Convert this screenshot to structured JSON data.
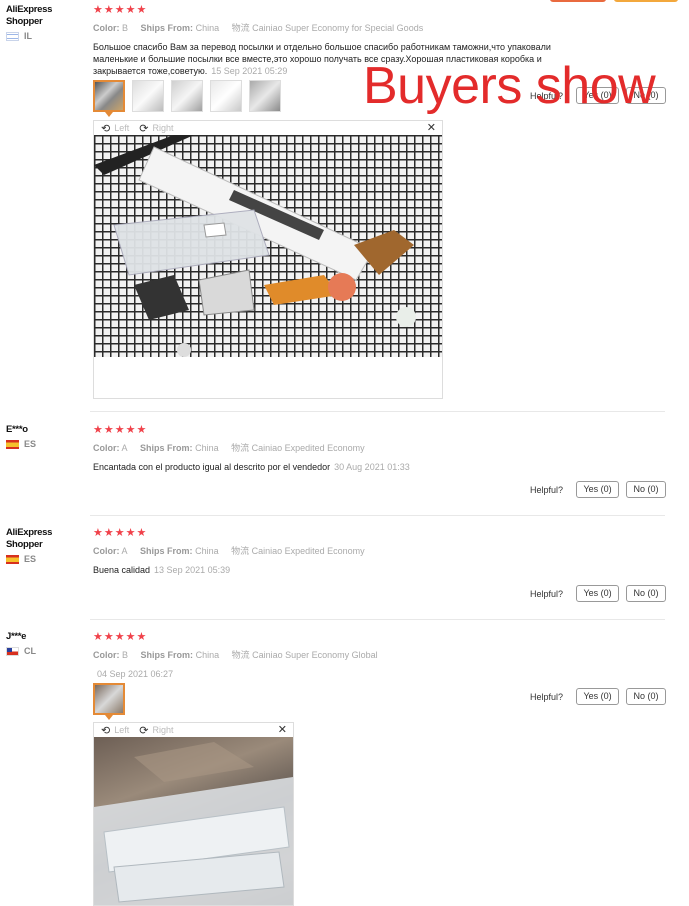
{
  "colors": {
    "star": "#f0414a",
    "accent": "#e48a36",
    "watermark": "#e32b2b"
  },
  "watermark": "Buyers show",
  "labels": {
    "color": "Color:",
    "ships_from": "Ships From:",
    "helpful": "Helpful?",
    "left": "Left",
    "right": "Right",
    "stars": "★★★★★"
  },
  "reviews": [
    {
      "user": "AliExpress Shopper",
      "country": "IL",
      "color": "B",
      "ships_from": "China",
      "logistics": "物流 Cainiao Super Economy for Special Goods",
      "text": "Большое спасибо Вам за перевод посылки и отдельно большое спасибо работникам таможни,что упаковали маленькие и большие посылки все вместе,это хорошо получать все сразу.Хорошая пластиковая коробка и закрывается тоже,советую.",
      "date": "15 Sep 2021 05:29",
      "yes": "Yes (0)",
      "no": "No (0)",
      "thumbs": 5
    },
    {
      "user": "E***o",
      "country": "ES",
      "color": "A",
      "ships_from": "China",
      "logistics": "物流 Cainiao Expedited Economy",
      "text": "Encantada con el producto igual al descrito por el vendedor",
      "date": "30 Aug 2021 01:33",
      "yes": "Yes (0)",
      "no": "No (0)"
    },
    {
      "user": "AliExpress Shopper",
      "country": "ES",
      "color": "A",
      "ships_from": "China",
      "logistics": "物流 Cainiao Expedited Economy",
      "text": "Buena calidad",
      "date": "13 Sep 2021 05:39",
      "yes": "Yes (0)",
      "no": "No (0)"
    },
    {
      "user": "J***e",
      "country": "CL",
      "color": "B",
      "ships_from": "China",
      "logistics": "物流 Cainiao Super Economy Global",
      "text": "",
      "date": "04 Sep 2021 06:27",
      "yes": "Yes (0)",
      "no": "No (0)",
      "thumbs": 1
    }
  ]
}
